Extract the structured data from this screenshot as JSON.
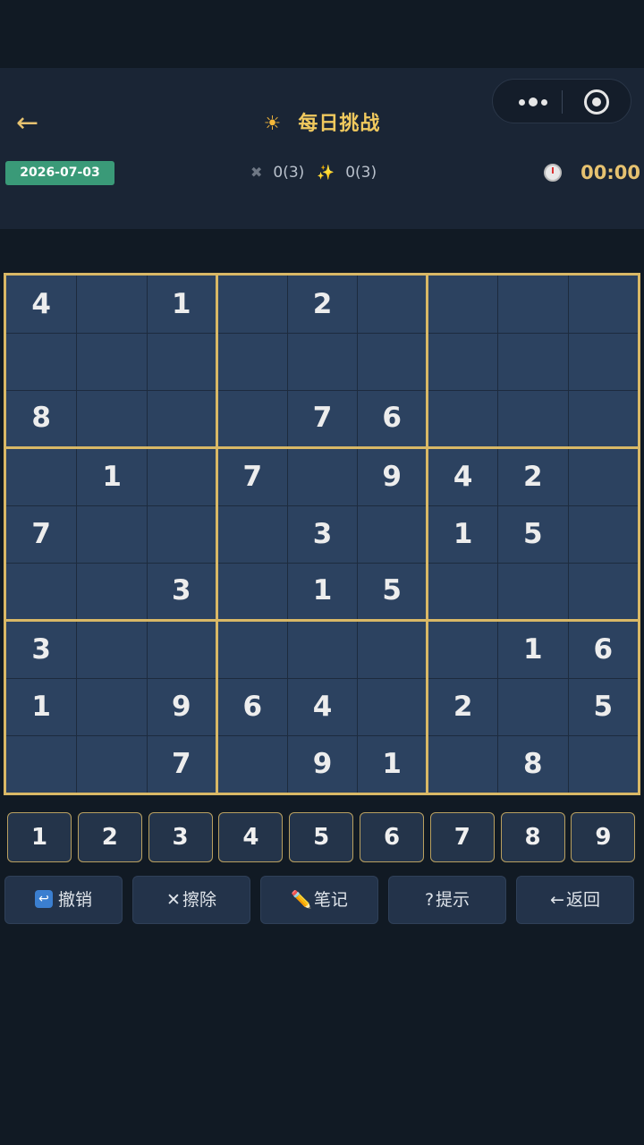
{
  "header": {
    "back_icon": "←",
    "title_icon": "☀",
    "title": "每日挑战",
    "date": "2026-07-03",
    "mistakes_icon": "✖",
    "mistakes": "0(3)",
    "hints_icon": "✨",
    "hints": "0(3)",
    "timer": "00:00"
  },
  "board": [
    [
      4,
      0,
      1,
      0,
      2,
      0,
      0,
      0,
      0
    ],
    [
      0,
      0,
      0,
      0,
      0,
      0,
      0,
      0,
      0
    ],
    [
      8,
      0,
      0,
      0,
      7,
      6,
      0,
      0,
      0
    ],
    [
      0,
      1,
      0,
      7,
      0,
      9,
      4,
      2,
      0
    ],
    [
      7,
      0,
      0,
      0,
      3,
      0,
      1,
      5,
      0
    ],
    [
      0,
      0,
      3,
      0,
      1,
      5,
      0,
      0,
      0
    ],
    [
      3,
      0,
      0,
      0,
      0,
      0,
      0,
      1,
      6
    ],
    [
      1,
      0,
      9,
      6,
      4,
      0,
      2,
      0,
      5
    ],
    [
      0,
      0,
      7,
      0,
      9,
      1,
      0,
      8,
      0
    ]
  ],
  "numpad": [
    "1",
    "2",
    "3",
    "4",
    "5",
    "6",
    "7",
    "8",
    "9"
  ],
  "actions": [
    {
      "icon": "↩",
      "label": "撤销",
      "name": "undo-button"
    },
    {
      "icon": "✕",
      "label": "擦除",
      "name": "erase-button"
    },
    {
      "icon": "✏️",
      "label": "笔记",
      "name": "notes-button"
    },
    {
      "icon": "?",
      "label": "提示",
      "name": "hint-button"
    },
    {
      "icon": "←",
      "label": "返回",
      "name": "return-button"
    }
  ],
  "colors": {
    "background": "#111a24",
    "header": "#1a2535",
    "cell": "#2c4260",
    "gold": "#d9b866",
    "title": "#f0c95e",
    "date_badge": "#3a9a78"
  }
}
